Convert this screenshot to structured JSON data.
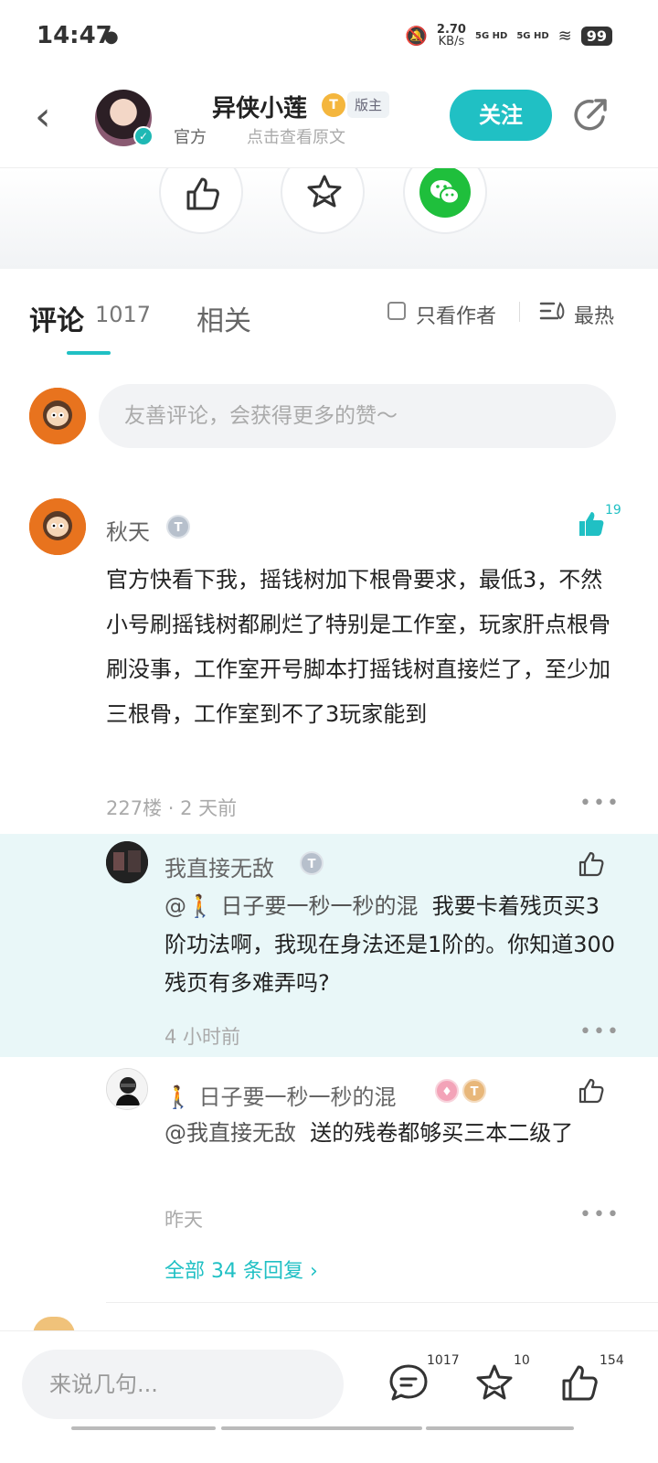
{
  "status_bar": {
    "time": "14:47",
    "speed": "2.70",
    "speed_unit": "KB/s",
    "net1": "5G HD",
    "net2": "5G HD",
    "battery": "99"
  },
  "header": {
    "author_name": "异侠小莲",
    "level_badge": "T",
    "role_badge": "版主",
    "tag": "官方",
    "view_original": "点击查看原文",
    "follow_label": "关注"
  },
  "actions": {
    "likes": "154",
    "favorites": "10"
  },
  "tabs": {
    "comments_label": "评论",
    "comments_count": "1017",
    "related_label": "相关",
    "only_author": "只看作者",
    "sort": "最热"
  },
  "comment_input": {
    "placeholder": "友善评论，会获得更多的赞～"
  },
  "comment": {
    "user": "秋天",
    "likes": "19",
    "text": "官方快看下我，摇钱树加下根骨要求，最低3，不然小号刷摇钱树都刷烂了特别是工作室，玩家肝点根骨刷没事，工作室开号脚本打摇钱树直接烂了，至少加三根骨，工作室到不了3玩家能到",
    "floor": "227楼",
    "time": "2 天前"
  },
  "replies": [
    {
      "user": "我直接无敌",
      "mention": "@🚶 日子要一秒一秒的混",
      "text": "我要卡着残页买3阶功法啊，我现在身法还是1阶的。你知道300残页有多难弄吗?",
      "time": "4 小时前"
    },
    {
      "user": "🚶 日子要一秒一秒的混",
      "mention": "@我直接无敌",
      "text": "送的残卷都够买三本二级了",
      "time": "昨天"
    }
  ],
  "all_replies": "全部 34 条回复 ›",
  "bottom_bar": {
    "placeholder": "来说几句...",
    "comments": "1017",
    "favorites": "10",
    "likes": "154"
  },
  "colors": {
    "accent": "#20c0c4",
    "highlight": "#e9f7f8"
  }
}
